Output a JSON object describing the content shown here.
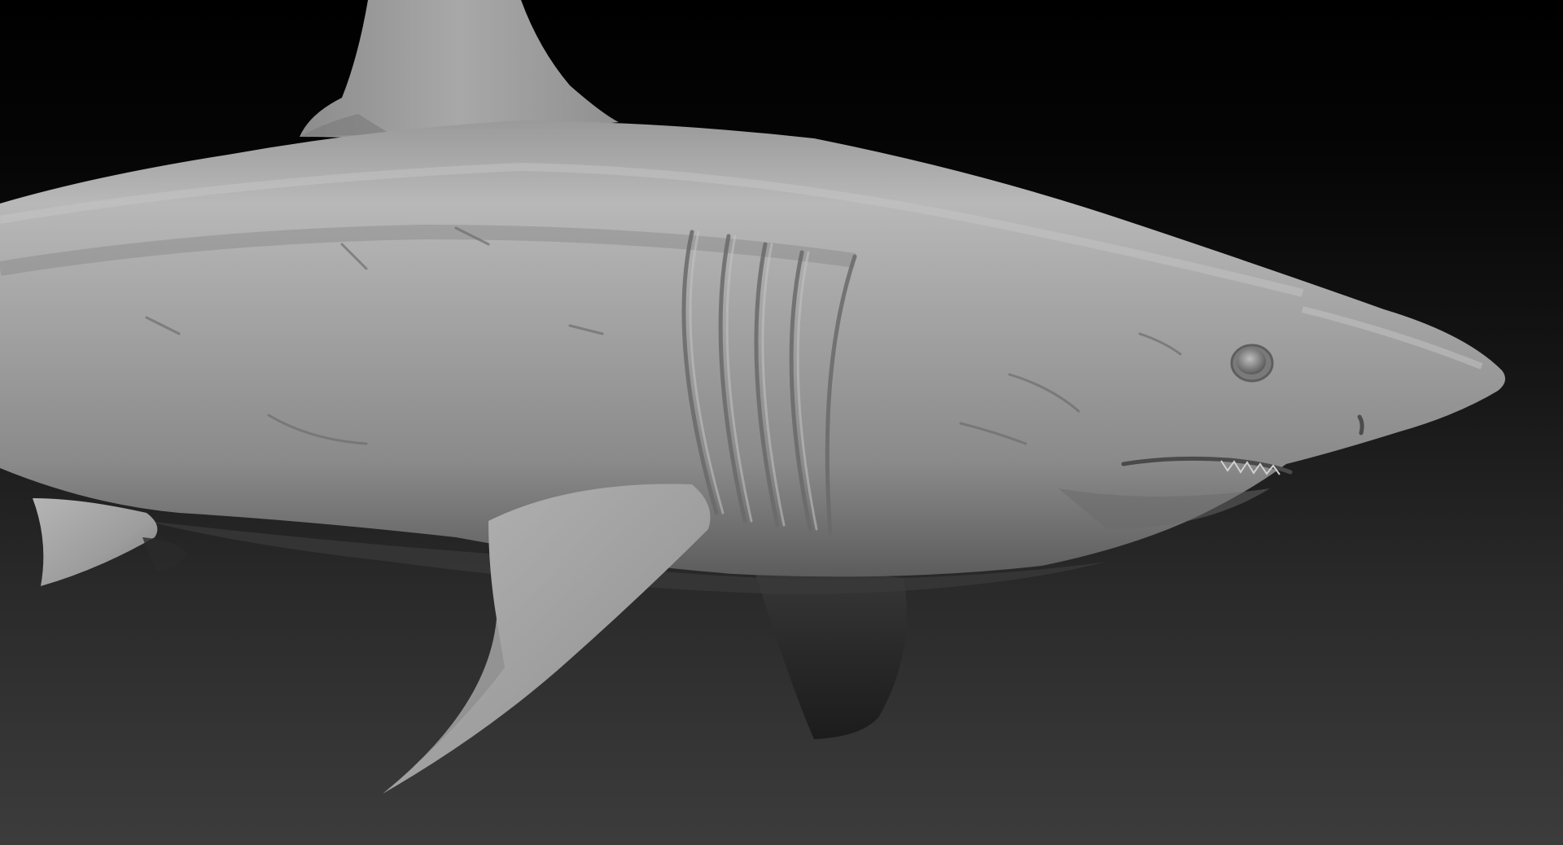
{
  "scene": {
    "subject": "shark-sculpt",
    "material": "matcap-gray",
    "colors": {
      "background_top": "#000000",
      "background_bottom": "#3c3c3c",
      "body_light": "#b4b4b4",
      "body_mid": "#8e8e8e",
      "body_dark": "#5a5a5a",
      "shadow": "#1e1e1e"
    }
  }
}
